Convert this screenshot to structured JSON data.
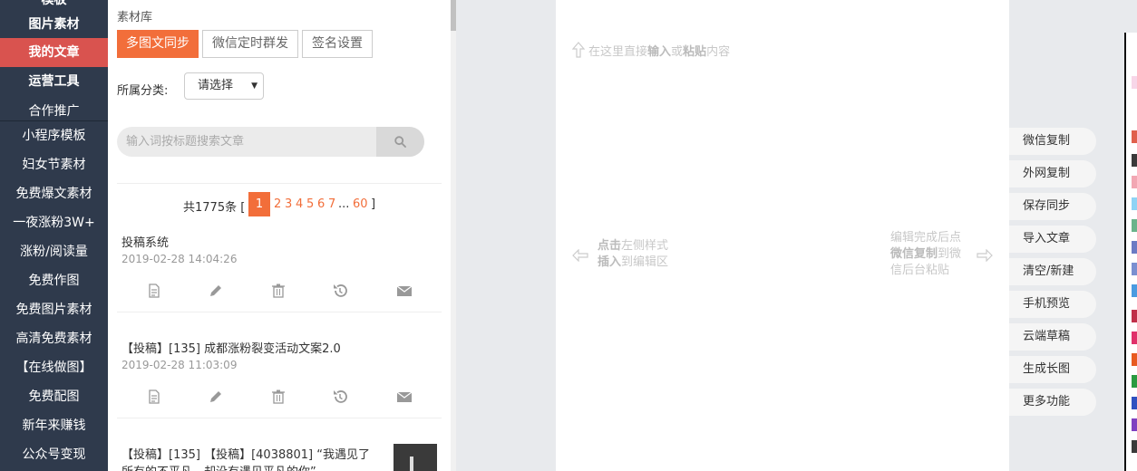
{
  "left_nav": {
    "items": [
      {
        "label": "模板",
        "bold": true
      },
      {
        "label": "图片素材",
        "bold": true
      },
      {
        "label": "我的文章",
        "bold": true,
        "active": true
      },
      {
        "label": "运营工具",
        "bold": true
      },
      {
        "label": "合作推广",
        "bold": false
      },
      {
        "label": "小程序模板",
        "bold": false
      },
      {
        "label": "妇女节素材",
        "bold": false
      },
      {
        "label": "免费爆文素材",
        "bold": false
      },
      {
        "label": "一夜涨粉3W+",
        "bold": false
      },
      {
        "label": "涨粉/阅读量",
        "bold": false
      },
      {
        "label": "免费作图",
        "bold": false
      },
      {
        "label": "免费图片素材",
        "bold": false
      },
      {
        "label": "高清免费素材",
        "bold": false
      },
      {
        "label": "【在线做图】",
        "bold": false
      },
      {
        "label": "免费配图",
        "bold": false
      },
      {
        "label": "新年来赚钱",
        "bold": false
      },
      {
        "label": "公众号变现",
        "bold": false
      }
    ],
    "active_color": "#d9534f",
    "bg_color": "#2f3a4c"
  },
  "panel": {
    "library_title": "素材库",
    "tabs": [
      {
        "label": "多图文同步",
        "active": true
      },
      {
        "label": "微信定时群发",
        "active": false
      },
      {
        "label": "签名设置",
        "active": false
      }
    ],
    "category_label": "所属分类:",
    "category_value": "请选择",
    "search_placeholder": "输入词按标题搜索文章",
    "pager": {
      "total_text": "共1775条 [",
      "current": "1",
      "pages": [
        "2",
        "3",
        "4",
        "5",
        "6",
        "7"
      ],
      "ellipsis": "...",
      "last": "60",
      "close": "]"
    },
    "articles": [
      {
        "title": "投稿系统",
        "date": "2019-02-28 14:04:26"
      },
      {
        "title": "【投稿】[135] 成都涨粉裂变活动文案2.0",
        "date": "2019-02-28 11:03:09"
      },
      {
        "title_line1": "【投稿】[135] 【投稿】[4038801] “我遇见了",
        "title_line2": "所有的不平凡，却没有遇见平凡的你”"
      }
    ],
    "action_icons": [
      "document-icon",
      "pencil-icon",
      "trash-icon",
      "history-icon",
      "mail-icon"
    ],
    "accent_color": "#f26e3a"
  },
  "editor": {
    "input_hint_pre": "在这里直接",
    "input_hint_b1": "输入",
    "input_hint_mid": "或",
    "input_hint_b2": "粘贴",
    "input_hint_post": "内容",
    "left_hint_b1": "点击",
    "left_hint_t1": "左侧样式",
    "left_hint_b2": "插入",
    "left_hint_t2": "到编辑区",
    "right_hint_t1": "编辑完成后点",
    "right_hint_b1": "微信复制",
    "right_hint_t2": "到微",
    "right_hint_t3": "信后台粘贴"
  },
  "side_buttons": [
    "微信复制",
    "外网复制",
    "保存同步",
    "导入文章",
    "清空/新建",
    "手机预览",
    "云端草稿",
    "生成长图",
    "更多功能"
  ],
  "strip_colors": [
    "#f7d6e8",
    "#e0604c",
    "#3a3a3a",
    "#f2a7b3",
    "#8fd3f5",
    "#6bb38b",
    "#6b7bc4",
    "#7a8fd0",
    "#4a9be0",
    "#c0304a",
    "#e0306a",
    "#e85a20",
    "#2a9a40",
    "#3050c0",
    "#8040c0",
    "#3a3a3a"
  ]
}
